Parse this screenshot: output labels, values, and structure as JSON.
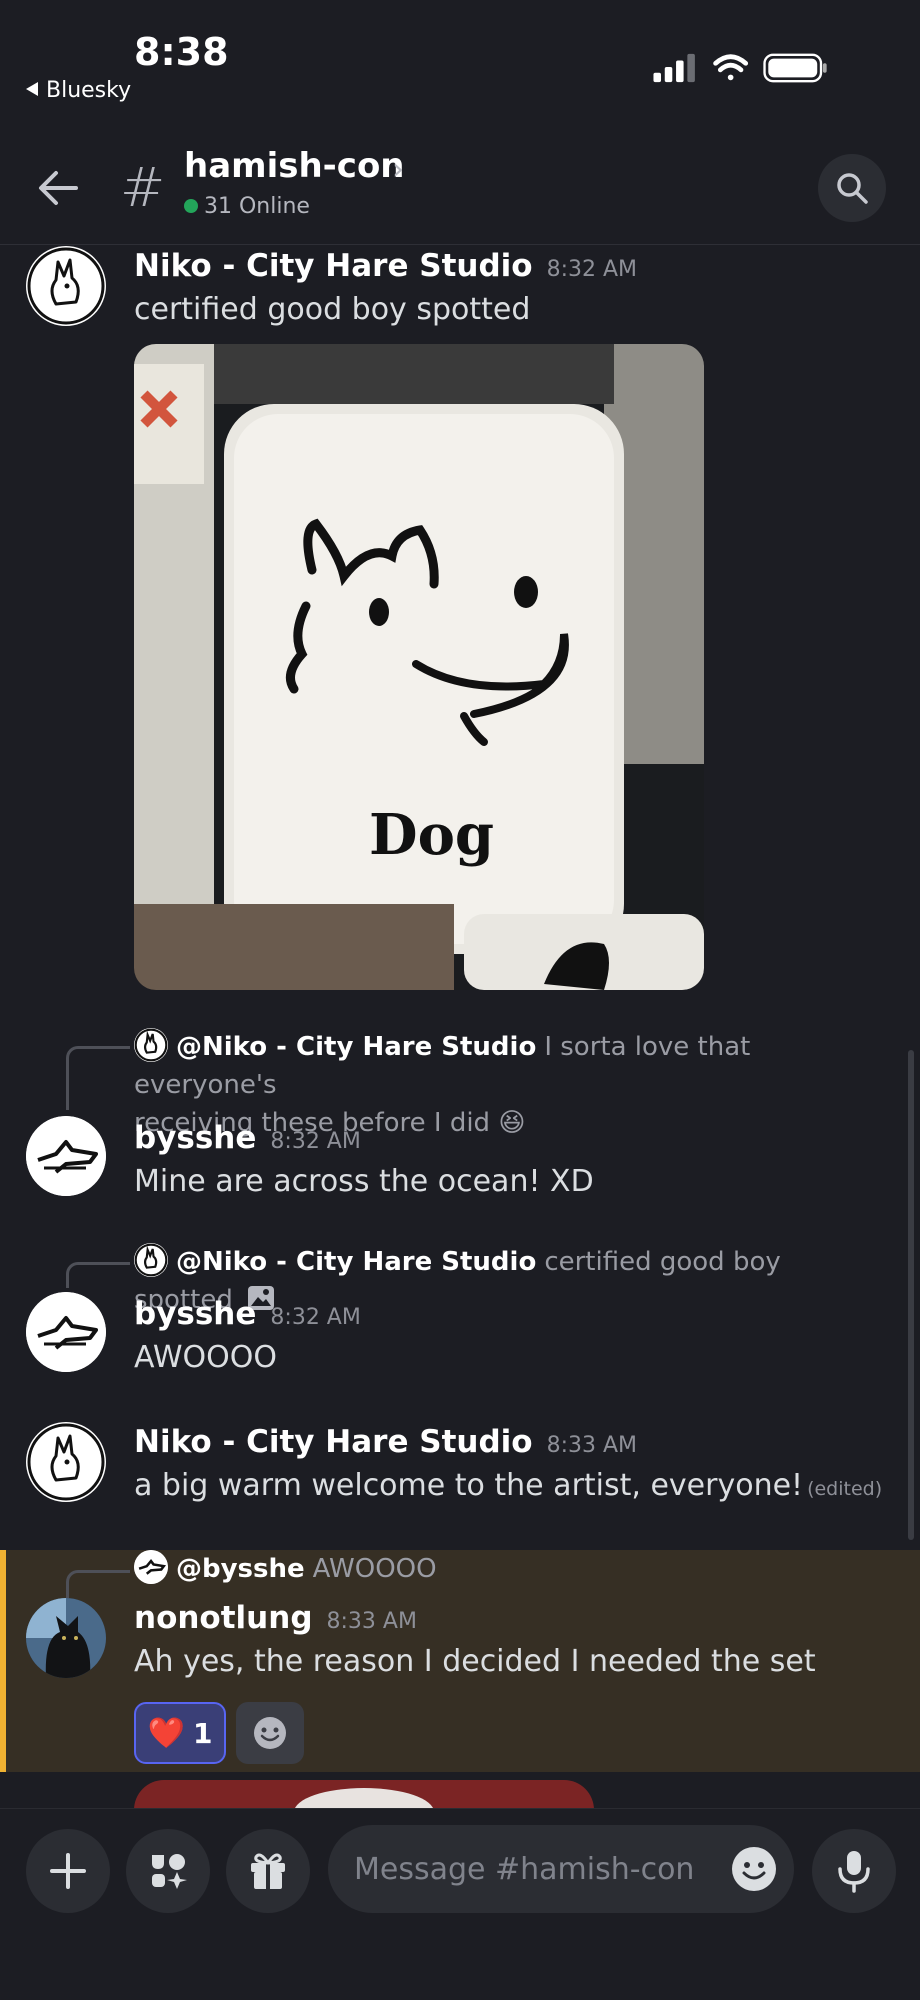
{
  "status_bar": {
    "time": "8:38",
    "back_app": "Bluesky"
  },
  "header": {
    "channel_name": "hamish-con",
    "online_count": "31 Online"
  },
  "messages": [
    {
      "author": "Niko - City Hare Studio",
      "time": "8:32 AM",
      "text": "certified good boy spotted",
      "attachment": {
        "caption": "Dog"
      }
    },
    {
      "reply_to": {
        "author": "@Niko - City Hare Studio",
        "text_line1": "I sorta love that everyone's",
        "text_line2": "receiving these before I did",
        "emoji": "😆"
      },
      "author": "bysshe",
      "time": "8:32 AM",
      "text": "Mine are across the ocean! XD"
    },
    {
      "reply_to": {
        "author": "@Niko - City Hare Studio",
        "text": "certified good boy spotted"
      },
      "author": "bysshe",
      "time": "8:32 AM",
      "text": "AWOOOO"
    },
    {
      "author": "Niko - City Hare Studio",
      "time": "8:33 AM",
      "text": "a big warm welcome to the artist, everyone!",
      "edited": "(edited)"
    },
    {
      "reply_to": {
        "author": "@bysshe",
        "text": "AWOOOO"
      },
      "author": "nonotlung",
      "time": "8:33 AM",
      "text": "Ah yes, the reason I decided I needed the set",
      "reactions": [
        {
          "emoji": "❤️",
          "count": "1"
        }
      ]
    }
  ],
  "composer": {
    "placeholder": "Message #hamish-con"
  },
  "colors": {
    "mention_highlight": "#f0b232",
    "reaction_border": "#5865f2",
    "online_dot": "#23a55a"
  },
  "icons": [
    "back-arrow-icon",
    "hash-icon",
    "chevron-right-icon",
    "search-icon",
    "plus-icon",
    "apps-icon",
    "gift-icon",
    "emoji-icon",
    "microphone-icon",
    "image-icon",
    "add-reaction-icon"
  ]
}
